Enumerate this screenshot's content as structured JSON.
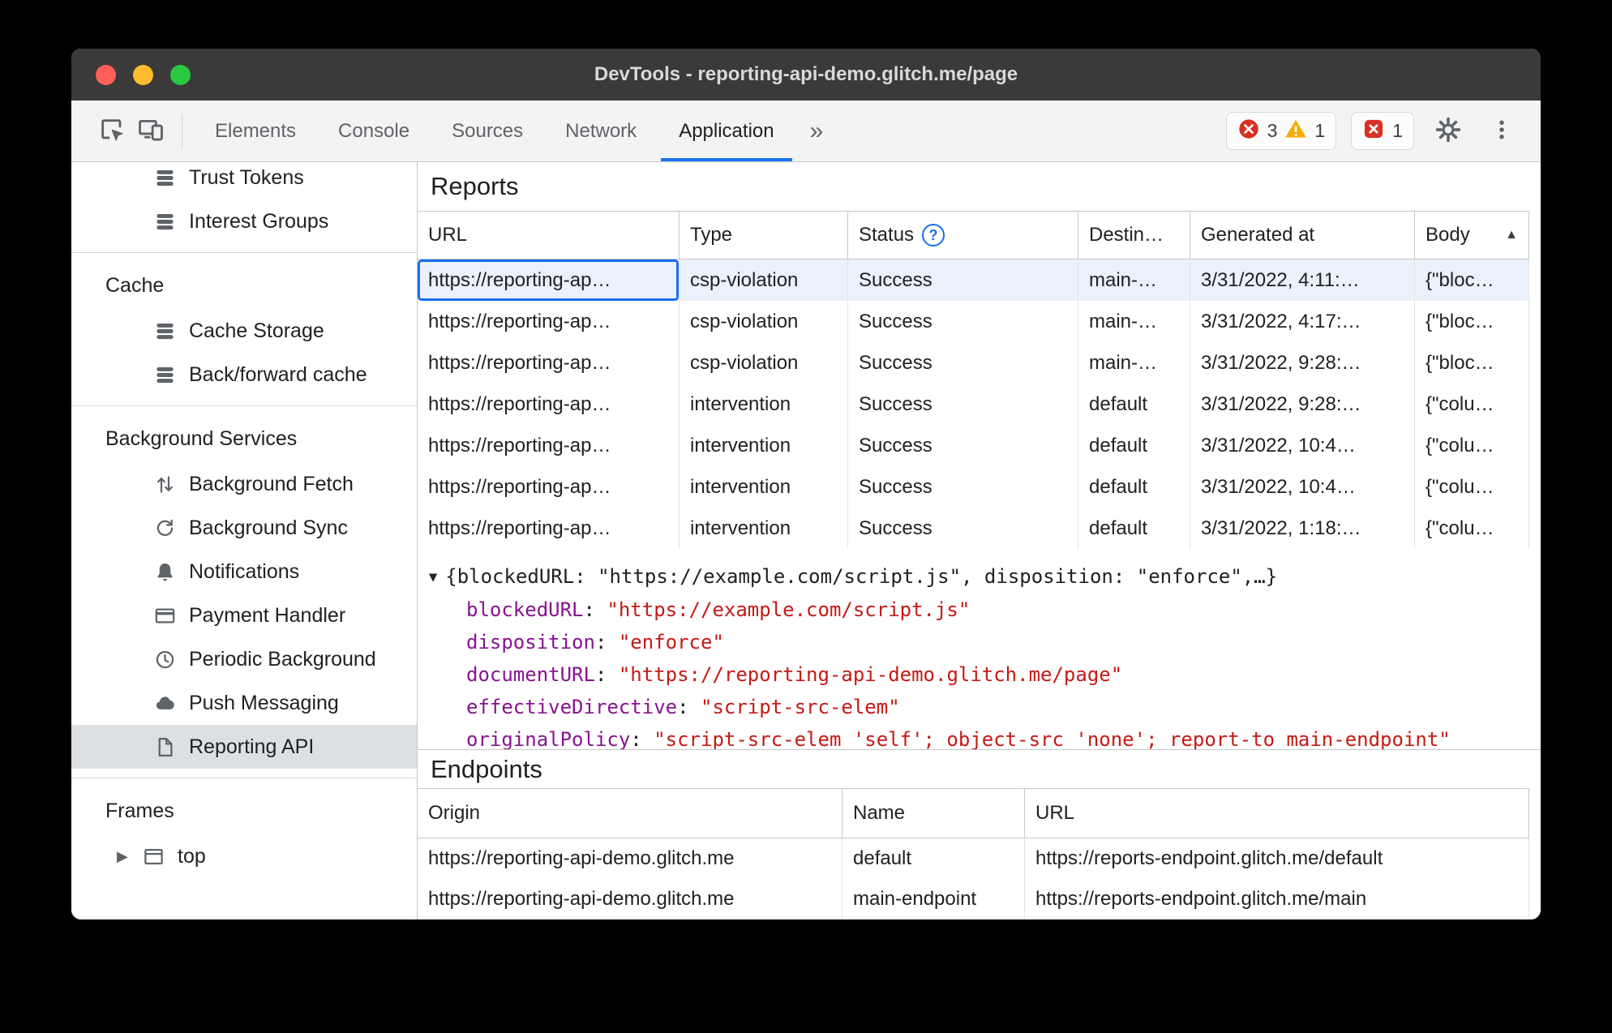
{
  "colors": {
    "accent": "#1a73e8",
    "error": "#d93025",
    "warning": "#f9ab00",
    "json_key": "#881391",
    "json_string": "#c41a16",
    "selected_row_bg": "#eaf1fb",
    "titlebar_bg": "#3a3a3a"
  },
  "window": {
    "title": "DevTools - reporting-api-demo.glitch.me/page"
  },
  "toolbar": {
    "tabs": [
      "Elements",
      "Console",
      "Sources",
      "Network",
      "Application"
    ],
    "selected_tab": "Application",
    "more_tabs_symbol": "»",
    "error_count": "3",
    "warning_count": "1",
    "issue_count": "1"
  },
  "sidebar": {
    "sections": [
      {
        "header": null,
        "items": [
          {
            "label": "Trust Tokens",
            "icon": "database-stack-icon"
          },
          {
            "label": "Interest Groups",
            "icon": "database-stack-icon"
          }
        ]
      },
      {
        "header": "Cache",
        "items": [
          {
            "label": "Cache Storage",
            "icon": "database-stack-icon"
          },
          {
            "label": "Back/forward cache",
            "icon": "database-stack-icon"
          }
        ]
      },
      {
        "header": "Background Services",
        "items": [
          {
            "label": "Background Fetch",
            "icon": "up-down-arrows-icon"
          },
          {
            "label": "Background Sync",
            "icon": "sync-icon"
          },
          {
            "label": "Notifications",
            "icon": "bell-icon"
          },
          {
            "label": "Payment Handler",
            "icon": "payment-card-icon"
          },
          {
            "label": "Periodic Background",
            "icon": "clock-icon"
          },
          {
            "label": "Push Messaging",
            "icon": "cloud-icon"
          },
          {
            "label": "Reporting API",
            "icon": "document-icon",
            "selected": true
          }
        ]
      },
      {
        "header": "Frames",
        "items": [
          {
            "label": "top",
            "icon": "frame-icon",
            "expander_symbol": "▶"
          }
        ]
      }
    ]
  },
  "reports": {
    "title": "Reports",
    "columns": [
      "URL",
      "Type",
      "Status",
      "Destin…",
      "Generated at",
      "Body"
    ],
    "status_help_symbol": "?",
    "sort_indicator": "▲",
    "rows": [
      {
        "url": "https://reporting-ap…",
        "type": "csp-violation",
        "status": "Success",
        "destination": "main-…",
        "generated_at": "3/31/2022, 4:11:…",
        "body": "{\"bloc…"
      },
      {
        "url": "https://reporting-ap…",
        "type": "csp-violation",
        "status": "Success",
        "destination": "main-…",
        "generated_at": "3/31/2022, 4:17:…",
        "body": "{\"bloc…"
      },
      {
        "url": "https://reporting-ap…",
        "type": "csp-violation",
        "status": "Success",
        "destination": "main-…",
        "generated_at": "3/31/2022, 9:28:…",
        "body": "{\"bloc…"
      },
      {
        "url": "https://reporting-ap…",
        "type": "intervention",
        "status": "Success",
        "destination": "default",
        "generated_at": "3/31/2022, 9:28:…",
        "body": "{\"colu…"
      },
      {
        "url": "https://reporting-ap…",
        "type": "intervention",
        "status": "Success",
        "destination": "default",
        "generated_at": "3/31/2022, 10:4…",
        "body": "{\"colu…"
      },
      {
        "url": "https://reporting-ap…",
        "type": "intervention",
        "status": "Success",
        "destination": "default",
        "generated_at": "3/31/2022, 10:4…",
        "body": "{\"colu…"
      },
      {
        "url": "https://reporting-ap…",
        "type": "intervention",
        "status": "Success",
        "destination": "default",
        "generated_at": "3/31/2022, 1:18:…",
        "body": "{\"colu…"
      }
    ]
  },
  "preview": {
    "expander_symbol": "▼",
    "summary": "{blockedURL: \"https://example.com/script.js\", disposition: \"enforce\",…}",
    "properties": [
      {
        "key": "blockedURL",
        "value": "\"https://example.com/script.js\""
      },
      {
        "key": "disposition",
        "value": "\"enforce\""
      },
      {
        "key": "documentURL",
        "value": "\"https://reporting-api-demo.glitch.me/page\""
      },
      {
        "key": "effectiveDirective",
        "value": "\"script-src-elem\""
      },
      {
        "key": "originalPolicy",
        "value": "\"script-src-elem 'self'; object-src 'none'; report-to main-endpoint\""
      }
    ]
  },
  "endpoints": {
    "title": "Endpoints",
    "columns": [
      "Origin",
      "Name",
      "URL"
    ],
    "rows": [
      {
        "origin": "https://reporting-api-demo.glitch.me",
        "name": "default",
        "url": "https://reports-endpoint.glitch.me/default"
      },
      {
        "origin": "https://reporting-api-demo.glitch.me",
        "name": "main-endpoint",
        "url": "https://reports-endpoint.glitch.me/main"
      }
    ]
  }
}
